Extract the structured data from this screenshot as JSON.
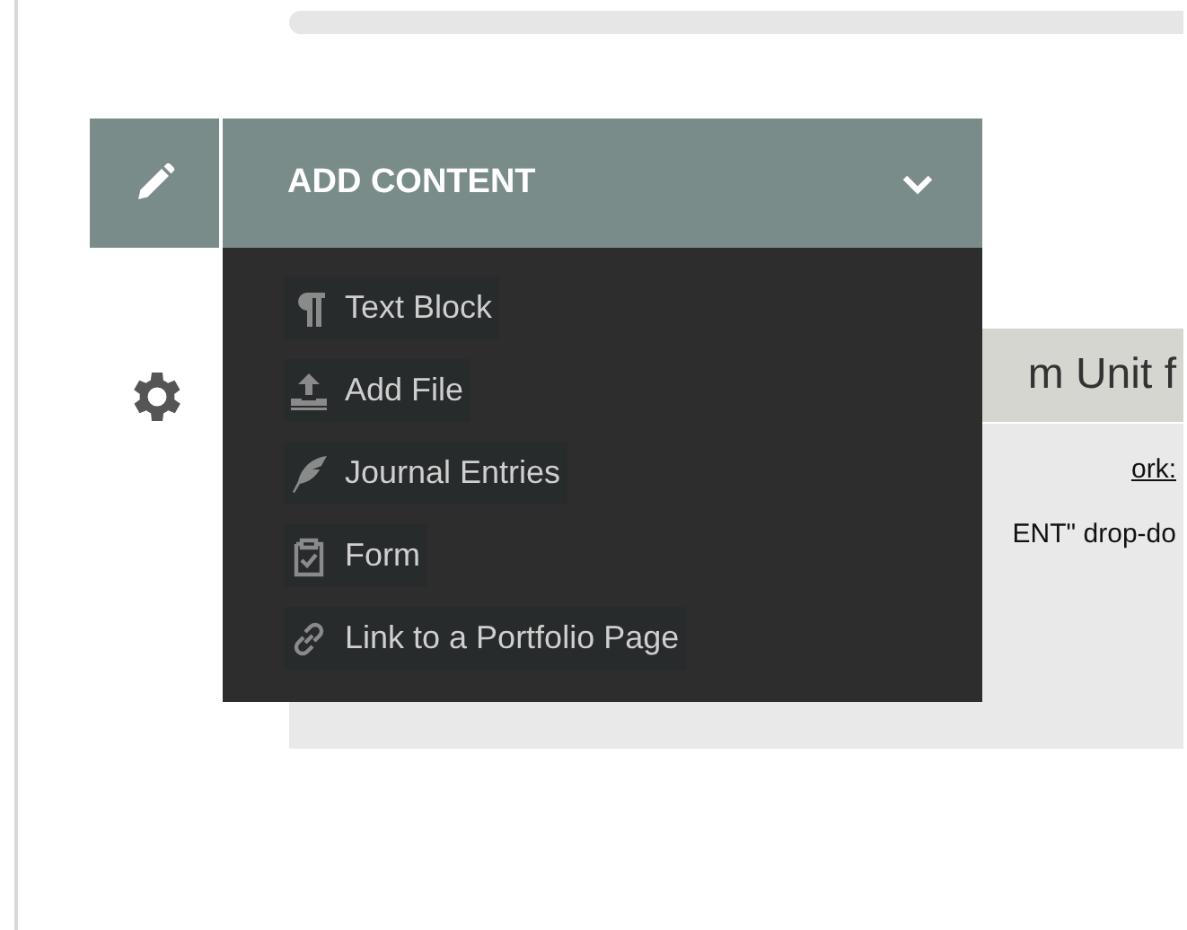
{
  "dropdown": {
    "title": "ADD CONTENT",
    "expanded": true,
    "items": [
      {
        "kind": "paragraph",
        "label": "Text Block"
      },
      {
        "kind": "upload",
        "label": "Add File"
      },
      {
        "kind": "feather",
        "label": "Journal Entries"
      },
      {
        "kind": "clipboard",
        "label": "Form"
      },
      {
        "kind": "link",
        "label": "Link to a Portfolio Page"
      }
    ]
  },
  "background": {
    "heading": "m Unit f",
    "lines": [
      {
        "text": "ork:",
        "underlined": true
      },
      {
        "text": "ENT\" drop-do",
        "underlined": false
      }
    ]
  }
}
